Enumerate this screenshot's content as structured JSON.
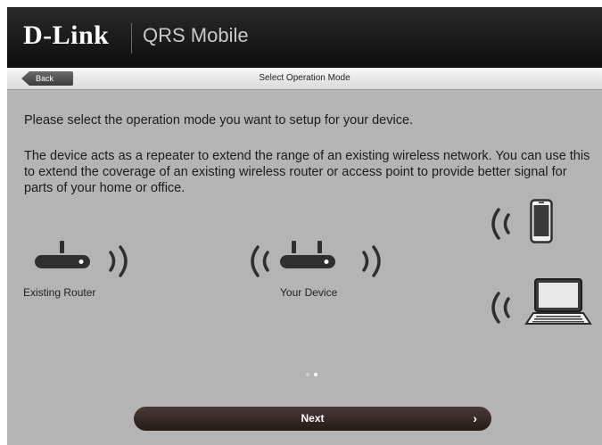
{
  "header": {
    "brand": "D-Link",
    "product": "QRS Mobile"
  },
  "navbar": {
    "back_label": "Back",
    "title": "Select Operation Mode"
  },
  "content": {
    "prompt": "Please select the operation mode you want to setup for your device.",
    "description": "The device acts as a repeater to extend the range of an existing wireless network. You can use this to extend the coverage of an existing wireless router or access point to provide better signal for parts of your home or office."
  },
  "diagram": {
    "existing_router_label": "Existing Router",
    "your_device_label": "Your Device",
    "icons": [
      "router-icon",
      "wifi-waves-icon",
      "smartphone-icon",
      "laptop-icon"
    ]
  },
  "pager": {
    "total": 2,
    "active": 2
  },
  "footer": {
    "next_label": "Next",
    "next_chevron": "›"
  },
  "colors": {
    "header_bg": "#111111",
    "body_bg": "#b4b4b4",
    "next_button_bg": "#3a2c2a",
    "icon_color": "#2f2f2f"
  }
}
